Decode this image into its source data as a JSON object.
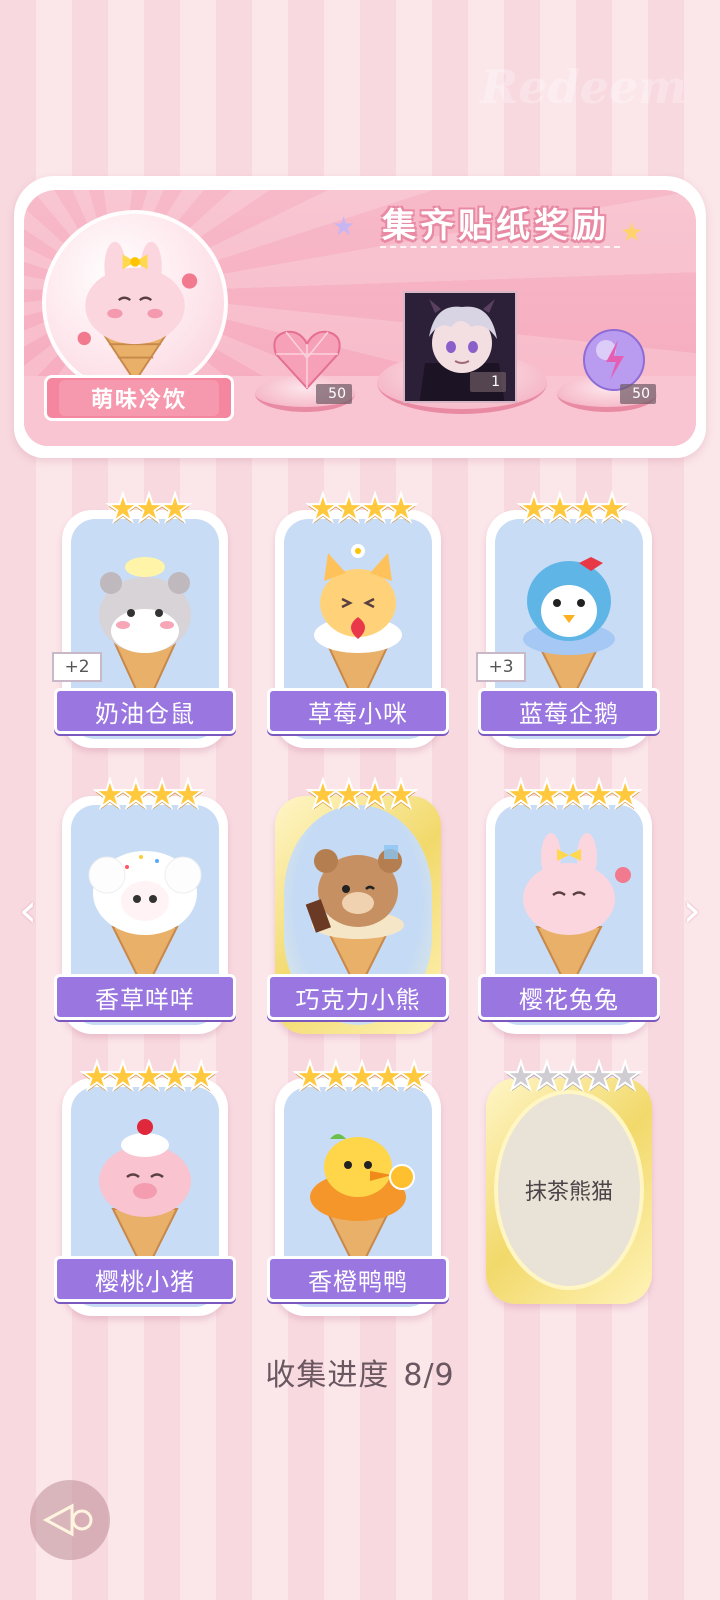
{
  "header": {
    "title": "集齐贴纸奖励",
    "watermark": "Redeem"
  },
  "theme": {
    "name": "萌味冷饮"
  },
  "rewards": [
    {
      "icon": "pink-heart-gem-icon",
      "count": "50"
    },
    {
      "icon": "character-portrait",
      "count": "1"
    },
    {
      "icon": "purple-energy-orb-icon",
      "count": "50"
    }
  ],
  "stickers": [
    {
      "name": "奶油仓鼠",
      "stars": 3,
      "extra": "+2",
      "collected": true
    },
    {
      "name": "草莓小咪",
      "stars": 4,
      "extra": "",
      "collected": true
    },
    {
      "name": "蓝莓企鹅",
      "stars": 4,
      "extra": "+3",
      "collected": true
    },
    {
      "name": "香草咩咩",
      "stars": 4,
      "extra": "",
      "collected": true
    },
    {
      "name": "巧克力小熊",
      "stars": 4,
      "extra": "",
      "collected": true
    },
    {
      "name": "樱花兔兔",
      "stars": 5,
      "extra": "",
      "collected": true
    },
    {
      "name": "樱桃小猪",
      "stars": 5,
      "extra": "",
      "collected": true
    },
    {
      "name": "香橙鸭鸭",
      "stars": 5,
      "extra": "",
      "collected": true
    },
    {
      "name": "抹茶熊猫",
      "stars": 5,
      "extra": "",
      "collected": false
    }
  ],
  "progress": {
    "label": "收集进度",
    "value": "8/9"
  },
  "colors": {
    "ribbon_purple": "#9a76e0",
    "star_gold": "#ffc83d",
    "panel_pink": "#f6a9bc"
  }
}
